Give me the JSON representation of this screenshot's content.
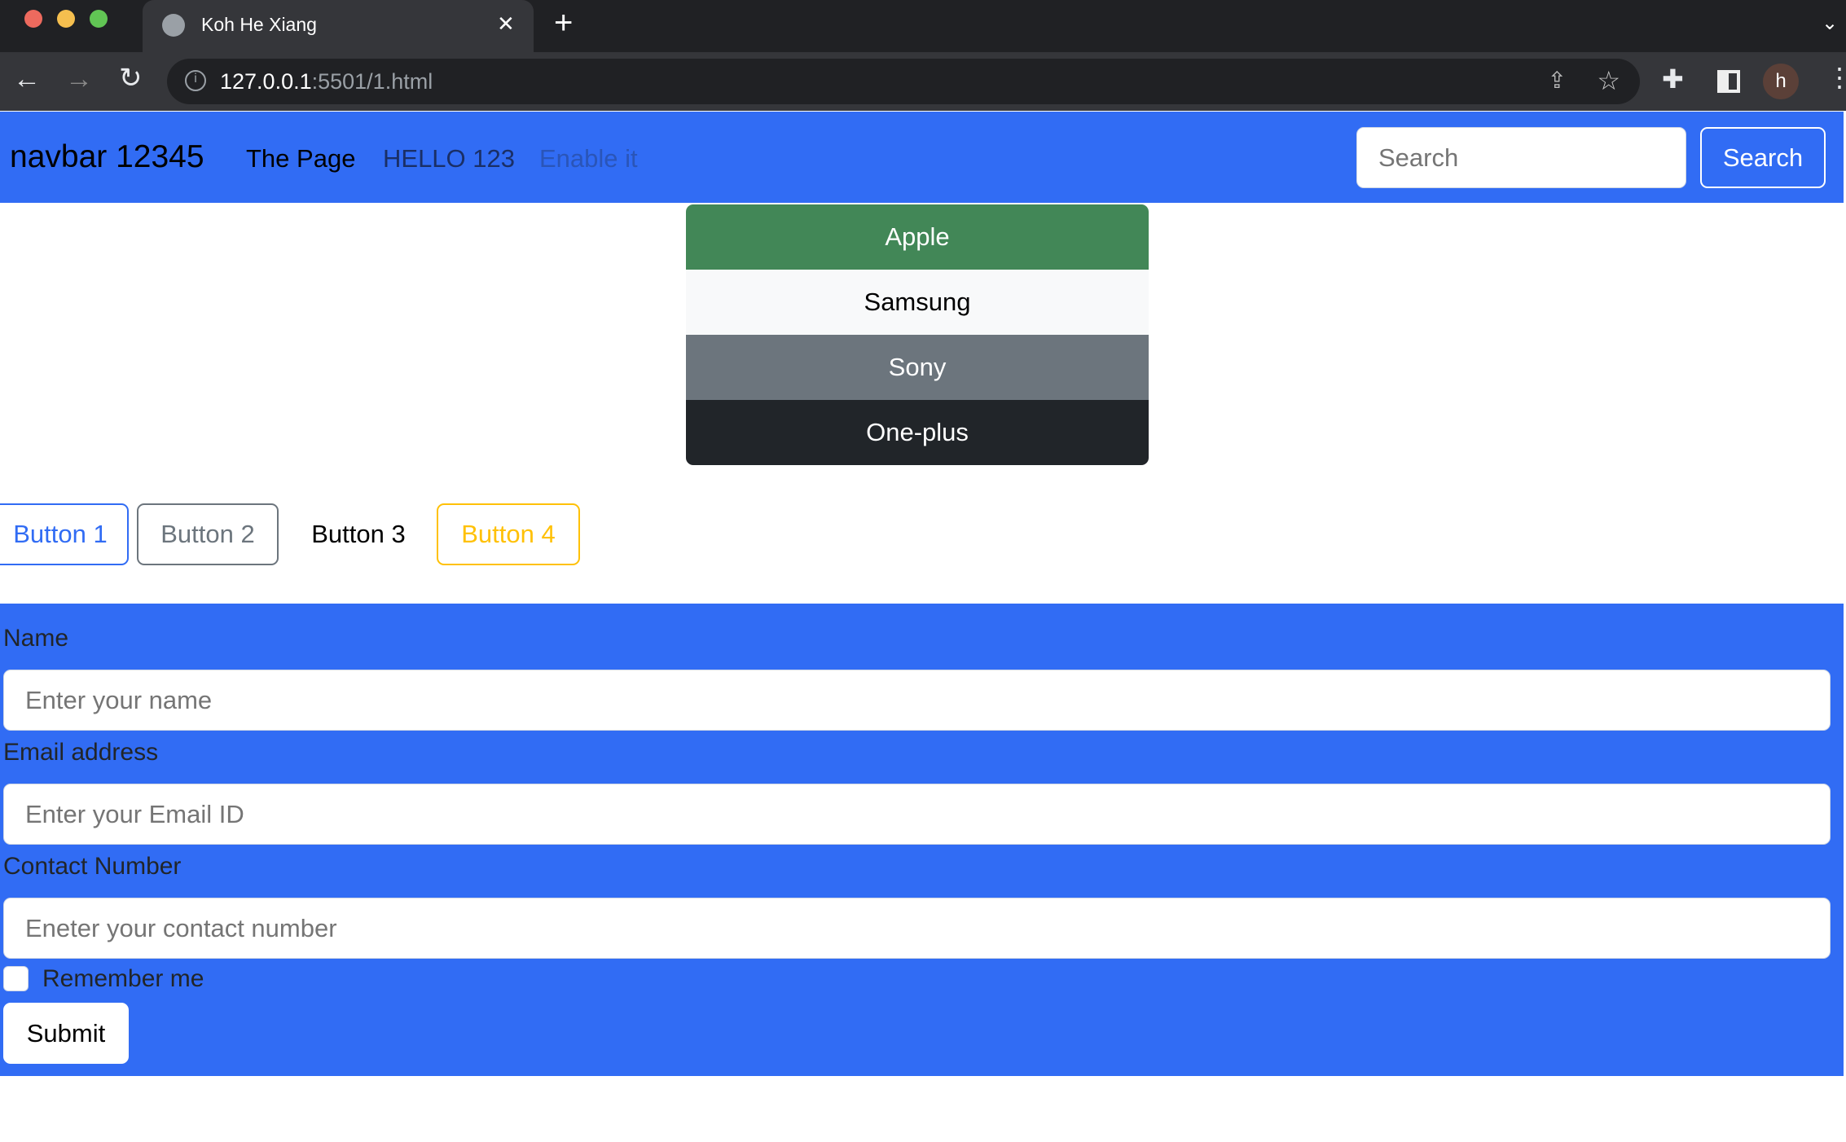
{
  "browser": {
    "tab_title": "Koh He Xiang",
    "url_host": "127.0.0.1",
    "url_rest": ":5501/1.html",
    "profile_initial": "h"
  },
  "navbar": {
    "brand": "navbar 12345",
    "links": [
      "The Page",
      "HELLO 123",
      "Enable it"
    ],
    "search_placeholder": "Search",
    "search_button": "Search"
  },
  "list_group": [
    "Apple",
    "Samsung",
    "Sony",
    "One-plus"
  ],
  "buttons": [
    "Button 1",
    "Button 2",
    "Button 3",
    "Button 4"
  ],
  "form": {
    "name_label": "Name",
    "name_placeholder": "Enter your name",
    "email_label": "Email address",
    "email_placeholder": "Enter your Email ID",
    "contact_label": "Contact Number",
    "contact_placeholder": "Eneter your contact number",
    "remember_label": "Remember me",
    "submit": "Submit"
  },
  "colors": {
    "primary": "#316cf4",
    "success": "#428757",
    "secondary": "#6c757d",
    "dark": "#212529",
    "warning": "#ffc107"
  }
}
